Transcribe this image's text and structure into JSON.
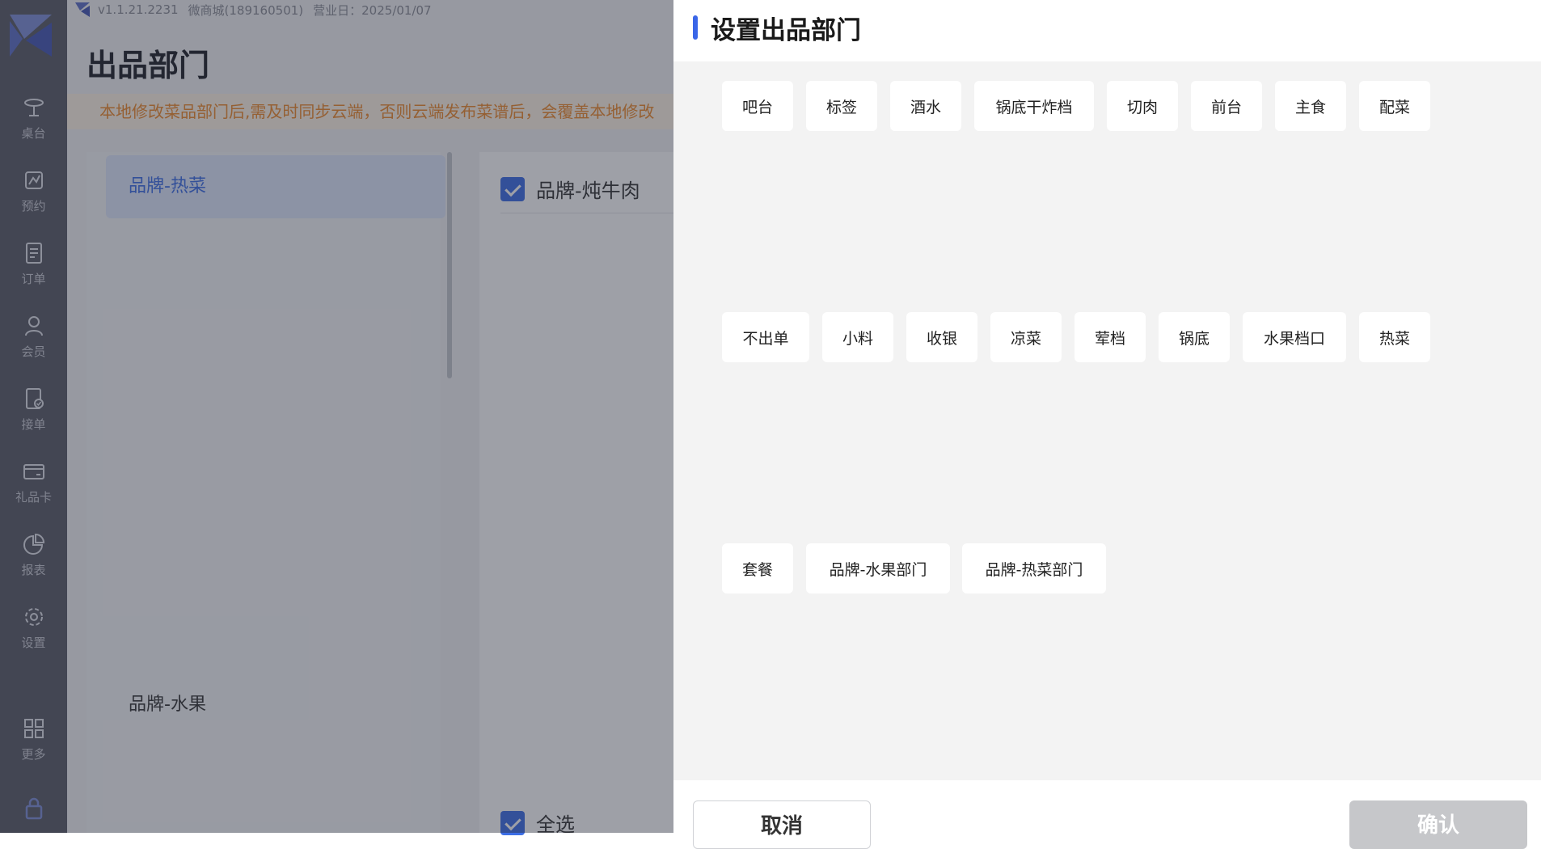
{
  "topbar": {
    "version": "v1.1.21.2231",
    "store": "微商城(189160501)",
    "business_day": "营业日：2025/01/07"
  },
  "page": {
    "title": "出品部门",
    "notice": "本地修改菜品部门后,需及时同步云端，否则云端发布菜谱后，会覆盖本地修改"
  },
  "sidebar": {
    "items": [
      {
        "label": "桌台",
        "icon": "table-icon"
      },
      {
        "label": "预约",
        "icon": "reservation-icon"
      },
      {
        "label": "订单",
        "icon": "order-icon"
      },
      {
        "label": "会员",
        "icon": "member-icon"
      },
      {
        "label": "接单",
        "icon": "accept-order-icon"
      },
      {
        "label": "礼品卡",
        "icon": "gift-card-icon"
      },
      {
        "label": "报表",
        "icon": "report-icon"
      },
      {
        "label": "设置",
        "icon": "settings-icon"
      },
      {
        "label": "更多",
        "icon": "more-icon"
      }
    ],
    "lock_icon": "lock-icon"
  },
  "left_list": {
    "active": "品牌-热菜",
    "other": "品牌-水果"
  },
  "right_panel": {
    "checked_item": "品牌-炖牛肉",
    "select_all": "全选"
  },
  "drawer": {
    "title": "设置出品部门",
    "departments": [
      "吧台",
      "标签",
      "酒水",
      "锅底干炸档",
      "切肉",
      "前台",
      "主食",
      "配菜",
      "不出单",
      "小料",
      "收银",
      "凉菜",
      "荤档",
      "锅底",
      "水果档口",
      "热菜",
      "套餐",
      "品牌-水果部门",
      "品牌-热菜部门"
    ],
    "cancel_label": "取消",
    "confirm_label": "确认"
  },
  "colors": {
    "accent": "#3a66e8",
    "sidebar_bg": "#5a5c66",
    "notice_text": "#ef8a2d",
    "confirm_disabled": "#c6c7ca"
  }
}
